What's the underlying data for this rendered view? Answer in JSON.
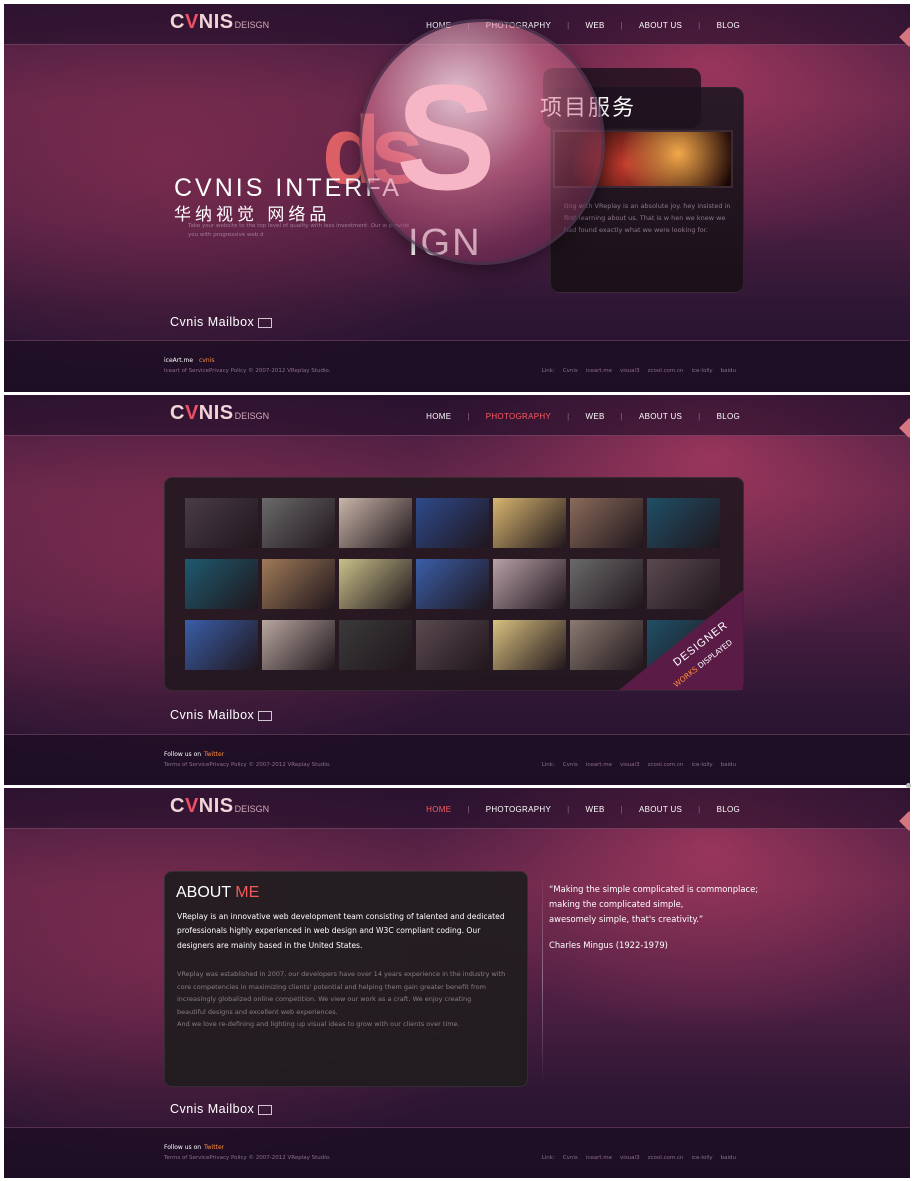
{
  "logo": {
    "text_c": "C",
    "text_v": "V",
    "text_nis": "NIS",
    "suffix": "DEISGN"
  },
  "nav": {
    "home": "HOME",
    "photography": "PHOTOGRAPHY",
    "web": "WEB",
    "about": "ABOUT US",
    "blog": "BLOG",
    "separator": "|"
  },
  "mailbox": "Cvnis Mailbox",
  "panel1": {
    "hero_title": "CVNIS INTERFA",
    "hero_cn": "华纳视觉 网络品",
    "hero_sub": "Take your website to the top level of quality with less investment. Our w provide you with progressive web d",
    "ds_text": "ds",
    "lens_letter": "S",
    "ign_text": "IGN",
    "service_title": "项目服务",
    "service_text": "ting with VReplay is an absolute joy. hey insisted in first learning about us. That is w hen we knew we had found exactly what we were looking for.",
    "footer_line1": "iceArt.me",
    "footer_line1_accent": "cvnis",
    "footer_line2": "Iceart of ServicePrivacy Policy  © 2007-2012 VReplay Studio.",
    "links": [
      "Link:",
      "Cvnis",
      "iceart.me",
      "visual3",
      "zcool.com.cn",
      "ice-lolly",
      "baidu"
    ]
  },
  "panel2": {
    "badge_line1": "DESIGNER",
    "badge_works": "WORKS",
    "badge_displayed": "DISPLAYED",
    "footer_line1": "Follow us on",
    "footer_line1_accent": "Twitter",
    "footer_line2": "Terms of ServicePrivacy Policy  © 2007-2012 VReplay Studio.",
    "links": [
      "Link:",
      "Cvnis",
      "iceart.me",
      "visual3",
      "zcool.com.cn",
      "ice-lolly",
      "baidu"
    ]
  },
  "panel3": {
    "about_title": "ABOUT",
    "about_title_accent": "ME",
    "about_lead": "VReplay is an innovative web development team consisting of talented and dedicated professionals highly experienced in web design and W3C compliant coding. Our designers are mainly based in the United States.",
    "about_body_1": "VReplay was established in 2007, our developers have over 14 years experience in the industry with core competencies in maximizing clients' potential and helping them gain greater benefit from increasingly globalized online competition. We view our work as a craft. We enjoy creating",
    "about_body_2": "beautiful designs and excellent web experiences.",
    "about_body_3": "And we love re-defining and lighting up visual ideas to grow with our clients over time.",
    "quote_1": "“Making the simple complicated is commonplace;",
    "quote_2": "making the complicated simple,",
    "quote_3": "awesomely simple, that's creativity.”",
    "quote_author": "Charles Mingus (1922-1979)",
    "footer_line1": "Follow us on",
    "footer_line1_accent": "Twitter",
    "footer_line2": "Terms of ServicePrivacy Policy  © 2007-2012 VReplay Studio.",
    "links": [
      "Link:",
      "Cvnis",
      "iceart.me",
      "visual3",
      "zcool.com.cn",
      "ice-lolly",
      "baidu"
    ]
  },
  "thumb_colors": [
    [
      "#4a3c46",
      "#6a6a6a",
      "#c9b5a8",
      "#2e4a8c",
      "#d8b670",
      "#8a6b5a",
      "#1f4f66"
    ],
    [
      "#1e5a70",
      "#a07a58",
      "#c9c08a",
      "#3a5ea8",
      "#b8a0a8",
      "#6a6a6a",
      "#5a4a50"
    ],
    [
      "#3a5ea8",
      "#b8a6a0",
      "#3a3a3a",
      "#5a4a50",
      "#d8c080",
      "#8a7a70",
      "#1f4f66"
    ]
  ]
}
